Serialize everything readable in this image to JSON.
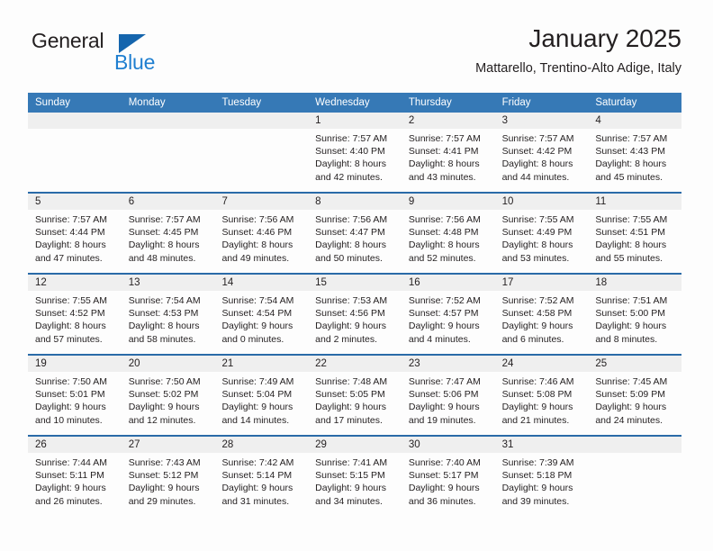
{
  "logo": {
    "word1": "General",
    "word2": "Blue",
    "triangle_color": "#1565ad",
    "blue_text_color": "#1f7fd0"
  },
  "header": {
    "title": "January 2025",
    "subtitle": "Mattarello, Trentino-Alto Adige, Italy"
  },
  "theme": {
    "header_blue": "#3679b6",
    "row_rule_blue": "#2a6ba8",
    "day_band_gray": "#efefef",
    "text": "#231f20"
  },
  "weekdays": [
    "Sunday",
    "Monday",
    "Tuesday",
    "Wednesday",
    "Thursday",
    "Friday",
    "Saturday"
  ],
  "weeks": [
    [
      {
        "day": "",
        "lines": []
      },
      {
        "day": "",
        "lines": []
      },
      {
        "day": "",
        "lines": []
      },
      {
        "day": "1",
        "lines": [
          "Sunrise: 7:57 AM",
          "Sunset: 4:40 PM",
          "Daylight: 8 hours",
          "and 42 minutes."
        ]
      },
      {
        "day": "2",
        "lines": [
          "Sunrise: 7:57 AM",
          "Sunset: 4:41 PM",
          "Daylight: 8 hours",
          "and 43 minutes."
        ]
      },
      {
        "day": "3",
        "lines": [
          "Sunrise: 7:57 AM",
          "Sunset: 4:42 PM",
          "Daylight: 8 hours",
          "and 44 minutes."
        ]
      },
      {
        "day": "4",
        "lines": [
          "Sunrise: 7:57 AM",
          "Sunset: 4:43 PM",
          "Daylight: 8 hours",
          "and 45 minutes."
        ]
      }
    ],
    [
      {
        "day": "5",
        "lines": [
          "Sunrise: 7:57 AM",
          "Sunset: 4:44 PM",
          "Daylight: 8 hours",
          "and 47 minutes."
        ]
      },
      {
        "day": "6",
        "lines": [
          "Sunrise: 7:57 AM",
          "Sunset: 4:45 PM",
          "Daylight: 8 hours",
          "and 48 minutes."
        ]
      },
      {
        "day": "7",
        "lines": [
          "Sunrise: 7:56 AM",
          "Sunset: 4:46 PM",
          "Daylight: 8 hours",
          "and 49 minutes."
        ]
      },
      {
        "day": "8",
        "lines": [
          "Sunrise: 7:56 AM",
          "Sunset: 4:47 PM",
          "Daylight: 8 hours",
          "and 50 minutes."
        ]
      },
      {
        "day": "9",
        "lines": [
          "Sunrise: 7:56 AM",
          "Sunset: 4:48 PM",
          "Daylight: 8 hours",
          "and 52 minutes."
        ]
      },
      {
        "day": "10",
        "lines": [
          "Sunrise: 7:55 AM",
          "Sunset: 4:49 PM",
          "Daylight: 8 hours",
          "and 53 minutes."
        ]
      },
      {
        "day": "11",
        "lines": [
          "Sunrise: 7:55 AM",
          "Sunset: 4:51 PM",
          "Daylight: 8 hours",
          "and 55 minutes."
        ]
      }
    ],
    [
      {
        "day": "12",
        "lines": [
          "Sunrise: 7:55 AM",
          "Sunset: 4:52 PM",
          "Daylight: 8 hours",
          "and 57 minutes."
        ]
      },
      {
        "day": "13",
        "lines": [
          "Sunrise: 7:54 AM",
          "Sunset: 4:53 PM",
          "Daylight: 8 hours",
          "and 58 minutes."
        ]
      },
      {
        "day": "14",
        "lines": [
          "Sunrise: 7:54 AM",
          "Sunset: 4:54 PM",
          "Daylight: 9 hours",
          "and 0 minutes."
        ]
      },
      {
        "day": "15",
        "lines": [
          "Sunrise: 7:53 AM",
          "Sunset: 4:56 PM",
          "Daylight: 9 hours",
          "and 2 minutes."
        ]
      },
      {
        "day": "16",
        "lines": [
          "Sunrise: 7:52 AM",
          "Sunset: 4:57 PM",
          "Daylight: 9 hours",
          "and 4 minutes."
        ]
      },
      {
        "day": "17",
        "lines": [
          "Sunrise: 7:52 AM",
          "Sunset: 4:58 PM",
          "Daylight: 9 hours",
          "and 6 minutes."
        ]
      },
      {
        "day": "18",
        "lines": [
          "Sunrise: 7:51 AM",
          "Sunset: 5:00 PM",
          "Daylight: 9 hours",
          "and 8 minutes."
        ]
      }
    ],
    [
      {
        "day": "19",
        "lines": [
          "Sunrise: 7:50 AM",
          "Sunset: 5:01 PM",
          "Daylight: 9 hours",
          "and 10 minutes."
        ]
      },
      {
        "day": "20",
        "lines": [
          "Sunrise: 7:50 AM",
          "Sunset: 5:02 PM",
          "Daylight: 9 hours",
          "and 12 minutes."
        ]
      },
      {
        "day": "21",
        "lines": [
          "Sunrise: 7:49 AM",
          "Sunset: 5:04 PM",
          "Daylight: 9 hours",
          "and 14 minutes."
        ]
      },
      {
        "day": "22",
        "lines": [
          "Sunrise: 7:48 AM",
          "Sunset: 5:05 PM",
          "Daylight: 9 hours",
          "and 17 minutes."
        ]
      },
      {
        "day": "23",
        "lines": [
          "Sunrise: 7:47 AM",
          "Sunset: 5:06 PM",
          "Daylight: 9 hours",
          "and 19 minutes."
        ]
      },
      {
        "day": "24",
        "lines": [
          "Sunrise: 7:46 AM",
          "Sunset: 5:08 PM",
          "Daylight: 9 hours",
          "and 21 minutes."
        ]
      },
      {
        "day": "25",
        "lines": [
          "Sunrise: 7:45 AM",
          "Sunset: 5:09 PM",
          "Daylight: 9 hours",
          "and 24 minutes."
        ]
      }
    ],
    [
      {
        "day": "26",
        "lines": [
          "Sunrise: 7:44 AM",
          "Sunset: 5:11 PM",
          "Daylight: 9 hours",
          "and 26 minutes."
        ]
      },
      {
        "day": "27",
        "lines": [
          "Sunrise: 7:43 AM",
          "Sunset: 5:12 PM",
          "Daylight: 9 hours",
          "and 29 minutes."
        ]
      },
      {
        "day": "28",
        "lines": [
          "Sunrise: 7:42 AM",
          "Sunset: 5:14 PM",
          "Daylight: 9 hours",
          "and 31 minutes."
        ]
      },
      {
        "day": "29",
        "lines": [
          "Sunrise: 7:41 AM",
          "Sunset: 5:15 PM",
          "Daylight: 9 hours",
          "and 34 minutes."
        ]
      },
      {
        "day": "30",
        "lines": [
          "Sunrise: 7:40 AM",
          "Sunset: 5:17 PM",
          "Daylight: 9 hours",
          "and 36 minutes."
        ]
      },
      {
        "day": "31",
        "lines": [
          "Sunrise: 7:39 AM",
          "Sunset: 5:18 PM",
          "Daylight: 9 hours",
          "and 39 minutes."
        ]
      },
      {
        "day": "",
        "lines": []
      }
    ]
  ]
}
